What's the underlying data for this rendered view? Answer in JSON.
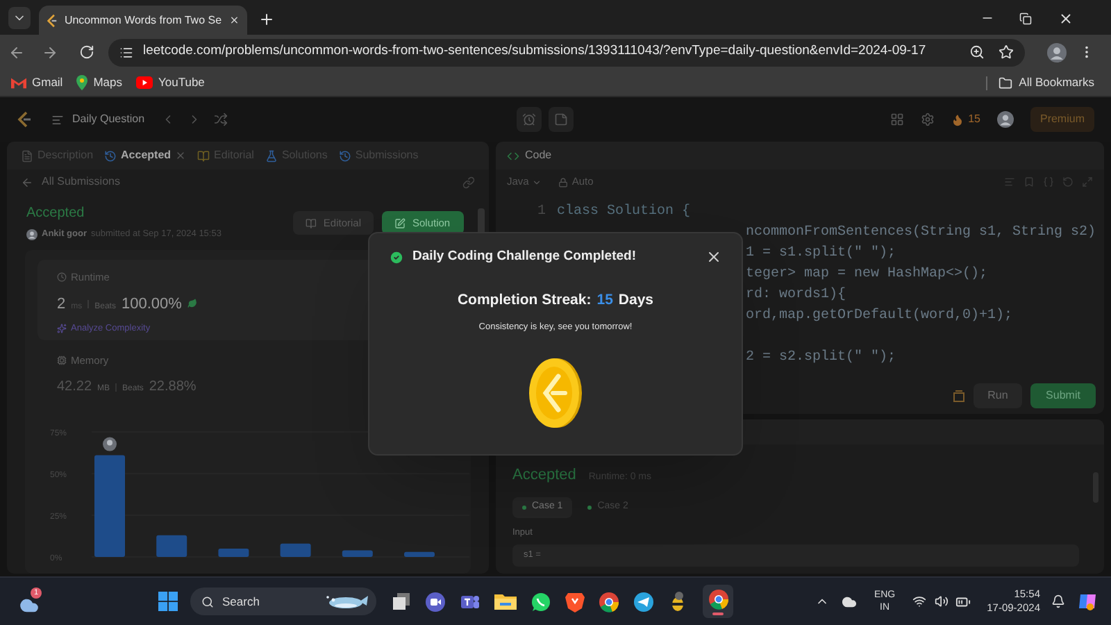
{
  "browser": {
    "tab": {
      "title": "Uncommon Words from Two Se",
      "selected": true
    },
    "url": "leetcode.com/problems/uncommon-words-from-two-sentences/submissions/1393111043/?envType=daily-question&envId=2024-09-17",
    "bookmarks": [
      {
        "label": "Gmail",
        "kind": "gmail"
      },
      {
        "label": "Maps",
        "kind": "maps"
      },
      {
        "label": "YouTube",
        "kind": "youtube"
      }
    ],
    "all_bookmarks": "All Bookmarks"
  },
  "nav": {
    "title": "Daily Question",
    "streak": "15",
    "premium": "Premium"
  },
  "left": {
    "tabs": [
      {
        "label": "Description",
        "selected": false,
        "closable": false
      },
      {
        "label": "Accepted",
        "selected": true,
        "closable": true
      },
      {
        "label": "Editorial",
        "selected": false,
        "closable": false
      },
      {
        "label": "Solutions",
        "selected": false,
        "closable": false
      },
      {
        "label": "Submissions",
        "selected": false,
        "closable": false
      }
    ],
    "back_link": "All Submissions",
    "status": "Accepted",
    "author": "Ankit goor",
    "submitted": "submitted at Sep 17, 2024 15:53",
    "buttons": [
      {
        "label": "Editorial",
        "kind": "secondary"
      },
      {
        "label": "Solution",
        "kind": "primary"
      }
    ],
    "runtime": {
      "title": "Runtime",
      "value": "2",
      "unit": "ms",
      "beats_label": "Beats",
      "beats": "100.00%",
      "link": "Analyze Complexity"
    },
    "memory": {
      "title": "Memory",
      "value": "42.22",
      "unit": "MB",
      "beats_label": "Beats",
      "beats": "22.88%"
    },
    "chart_data": {
      "type": "bar",
      "values": [
        61,
        13,
        5,
        8,
        4,
        3
      ],
      "ylim": [
        0,
        75
      ],
      "yticks": [
        {
          "value": 0,
          "label": "0%"
        },
        {
          "value": 25,
          "label": "25%"
        },
        {
          "value": 50,
          "label": "50%"
        },
        {
          "value": 75,
          "label": "75%"
        }
      ]
    }
  },
  "editor": {
    "title": "Code",
    "language": "Java",
    "mode": "Auto",
    "lines": [
      {
        "kind": "full",
        "number": "1",
        "text": "class Solution {"
      },
      {
        "kind": "clipped",
        "text": "ncommonFromSentences(String s1, String s2)"
      },
      {
        "kind": "clipped",
        "text": "1 = s1.split(\" \");"
      },
      {
        "kind": "clipped",
        "text": "teger> map = new HashMap<>();"
      },
      {
        "kind": "clipped",
        "text": "rd: words1){"
      },
      {
        "kind": "clipped",
        "text": "ord,map.getOrDefault(word,0)+1);"
      },
      {
        "kind": "blank"
      },
      {
        "kind": "clipped",
        "text": "2 = s2.split(\" \");"
      }
    ],
    "run": "Run",
    "submit": "Submit"
  },
  "result": {
    "status": "Accepted",
    "runtime": "Runtime: 0 ms",
    "cases": [
      {
        "label": "Case 1",
        "selected": true
      },
      {
        "label": "Case 2",
        "selected": false
      }
    ],
    "input_label": "Input",
    "input_value": "s1 ="
  },
  "modal": {
    "title": "Daily Coding Challenge Completed!",
    "streak_label": "Completion Streak:",
    "streak_value": "15",
    "streak_unit": "Days",
    "message": "Consistency is key, see you tomorrow!"
  },
  "taskbar": {
    "weather_badge": "1",
    "search": "Search",
    "language": "ENG",
    "region": "IN",
    "time": "15:54",
    "date": "17-09-2024"
  }
}
